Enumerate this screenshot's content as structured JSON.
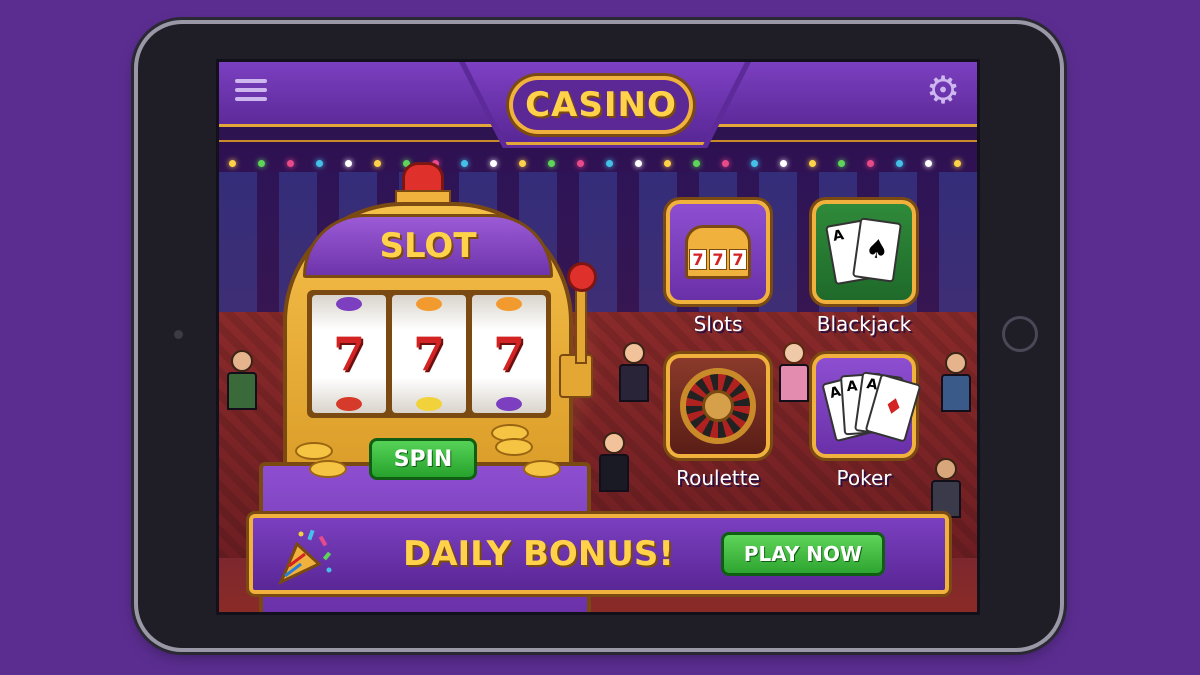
{
  "header": {
    "logo_text": "CASINO",
    "menu_icon": "hamburger-menu-icon",
    "settings_icon": "gear-icon"
  },
  "slot_machine": {
    "title": "SLOT",
    "reels": [
      "7",
      "7",
      "7"
    ],
    "spin_label": "SPIN"
  },
  "games": [
    {
      "label": "Slots",
      "icon": "slot-machine-icon"
    },
    {
      "label": "Blackjack",
      "icon": "playing-cards-icon"
    },
    {
      "label": "Roulette",
      "icon": "roulette-wheel-icon"
    },
    {
      "label": "Poker",
      "icon": "poker-cards-icon"
    }
  ],
  "mini_slot_reels": [
    "7",
    "7",
    "7"
  ],
  "blackjack_cards": [
    "A",
    "♠"
  ],
  "poker_cards": [
    "A",
    "A",
    "A",
    "♦"
  ],
  "bonus": {
    "title": "DAILY BONUS!",
    "play_label": "PLAY NOW",
    "icon": "party-popper-icon"
  },
  "colors": {
    "background": "#5b2d91",
    "accent_gold": "#f0b23c",
    "button_green": "#2ea530",
    "header_purple": "#7b3fc0"
  }
}
